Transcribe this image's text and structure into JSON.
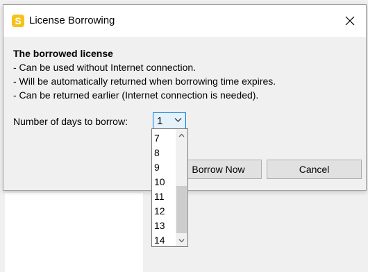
{
  "dialog": {
    "title": "License Borrowing",
    "app_icon_letter": "S",
    "close_icon": "close-icon"
  },
  "info": {
    "heading": "The borrowed license",
    "lines": [
      "- Can be used without Internet connection.",
      "- Will be automatically returned when borrowing time expires.",
      "- Can be returned earlier (Internet connection is needed)."
    ]
  },
  "days": {
    "label": "Number of days to borrow:",
    "selected": "1",
    "options_visible": [
      "7",
      "8",
      "9",
      "10",
      "11",
      "12",
      "13",
      "14"
    ]
  },
  "buttons": {
    "borrow": "Borrow Now",
    "cancel": "Cancel"
  },
  "colors": {
    "accent": "#0078d7",
    "app_icon": "#f6c21a"
  }
}
